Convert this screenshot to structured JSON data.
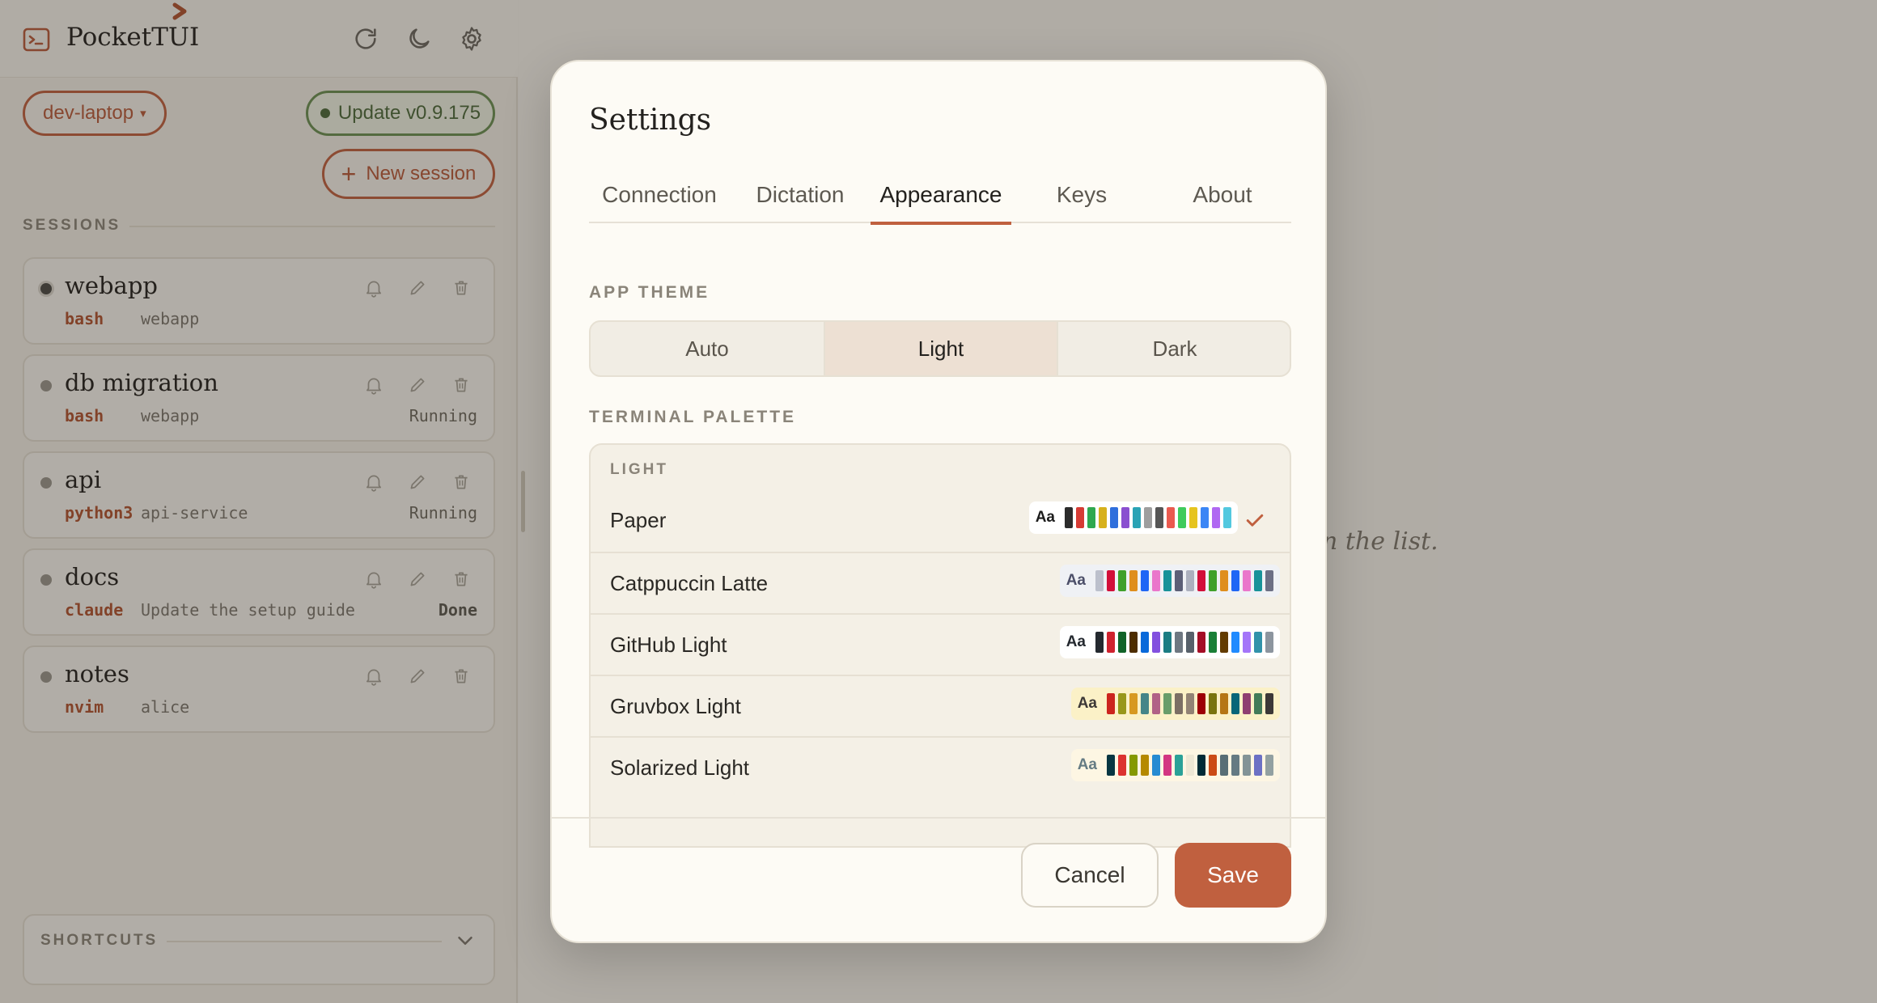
{
  "app": {
    "title": "PocketTUI",
    "icons": [
      "terminal-icon",
      "refresh-icon",
      "moon-icon",
      "gear-icon"
    ]
  },
  "sidebar": {
    "device": "dev-laptop",
    "device_caret": "▾",
    "update_label": "Update v0.9.175",
    "new_session_label": "New session",
    "new_session_icon": "+",
    "sessions_heading": "SESSIONS",
    "sessions": [
      {
        "name": "webapp",
        "cmd": "bash",
        "cwd": "webapp",
        "state": "",
        "active": true
      },
      {
        "name": "db migration",
        "cmd": "bash",
        "cwd": "webapp",
        "state": "Running",
        "active": false
      },
      {
        "name": "api",
        "cmd": "python3",
        "cwd": "api-service",
        "state": "Running",
        "active": false
      },
      {
        "name": "docs",
        "cmd": "claude",
        "cwd": "Update the setup guide",
        "state": "Done",
        "active": false
      },
      {
        "name": "notes",
        "cmd": "nvim",
        "cwd": "alice",
        "state": "",
        "active": false
      }
    ],
    "shortcuts_heading": "SHORTCUTS"
  },
  "main": {
    "hint_fragment": "n the list."
  },
  "settings": {
    "title": "Settings",
    "tabs": [
      "Connection",
      "Dictation",
      "Appearance",
      "Keys",
      "About"
    ],
    "active_tab": "Appearance",
    "app_theme_label": "APP THEME",
    "themes": [
      "Auto",
      "Light",
      "Dark"
    ],
    "active_theme": "Light",
    "terminal_palette_label": "TERMINAL PALETTE",
    "palette_group": "LIGHT",
    "palettes": [
      {
        "name": "Paper",
        "aa": "Aa",
        "bg": "#ffffff",
        "fg": "#1c1c1c",
        "selected": true,
        "colors": [
          "#2b2b2b",
          "#d63b34",
          "#2fa84f",
          "#d7b11c",
          "#2f6fdc",
          "#8a4fd0",
          "#2aa3b5",
          "#9e9e9e",
          "#555555",
          "#ea5a4f",
          "#3fcb5c",
          "#e6c41e",
          "#3b86f5",
          "#b068f2",
          "#52c8df"
        ]
      },
      {
        "name": "Catppuccin Latte",
        "aa": "Aa",
        "bg": "#eff1f5",
        "fg": "#4c4f69",
        "selected": false,
        "colors": [
          "#bcc0cc",
          "#d20f39",
          "#40a02b",
          "#df8e1d",
          "#1e66f5",
          "#ea76cb",
          "#179299",
          "#5c5f77",
          "#acb0be",
          "#d20f39",
          "#40a02b",
          "#df8e1d",
          "#1e66f5",
          "#ea76cb",
          "#179299",
          "#6c6f85"
        ]
      },
      {
        "name": "GitHub Light",
        "aa": "Aa",
        "bg": "#ffffff",
        "fg": "#24292f",
        "selected": false,
        "colors": [
          "#24292f",
          "#cf222e",
          "#116329",
          "#4d2d00",
          "#0969da",
          "#8250df",
          "#1b7c83",
          "#6e7781",
          "#57606a",
          "#a40e26",
          "#1a7f37",
          "#633c01",
          "#218bff",
          "#a475f9",
          "#3192aa",
          "#8c959f"
        ]
      },
      {
        "name": "Gruvbox Light",
        "aa": "Aa",
        "bg": "#fbf1c7",
        "fg": "#3c3836",
        "selected": false,
        "colors": [
          "#cc241d",
          "#98971a",
          "#d79921",
          "#458588",
          "#b16286",
          "#689d6a",
          "#7c6f64",
          "#928374",
          "#9d0006",
          "#79740e",
          "#b57614",
          "#076678",
          "#8f3f71",
          "#427b58",
          "#3c3836"
        ]
      },
      {
        "name": "Solarized Light",
        "aa": "Aa",
        "bg": "#fdf6e3",
        "fg": "#657b83",
        "selected": false,
        "colors": [
          "#073642",
          "#dc322f",
          "#859900",
          "#b58900",
          "#268bd2",
          "#d33682",
          "#2aa198",
          "#eee8d5",
          "#002b36",
          "#cb4b16",
          "#586e75",
          "#657b83",
          "#839496",
          "#6c71c4",
          "#93a1a1"
        ]
      }
    ],
    "cancel_label": "Cancel",
    "save_label": "Save",
    "accent": "#c0603f"
  }
}
